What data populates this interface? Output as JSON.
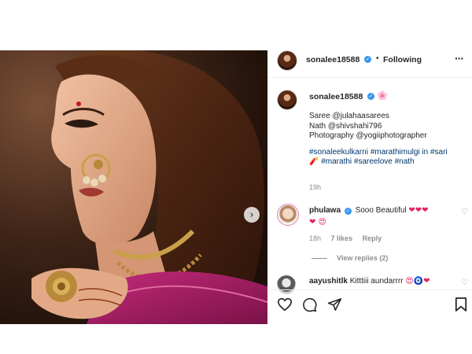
{
  "post": {
    "owner": {
      "username": "sonalee18588",
      "follow_status": "Following",
      "separator": "•"
    },
    "caption": {
      "username": "sonalee18588",
      "flower_emoji": "🌸",
      "lines": [
        "Saree @julahaasarees",
        "Nath @shivshahi796",
        "Photography @yogiiphotographer"
      ],
      "hashtags_line1": "#sonaleekulkarni #marathimulgi in #sari",
      "hashtags_line2_prefix": "🧨",
      "hashtags_line2": " #marathi #sareelove #nath",
      "time": "19h"
    },
    "comments": [
      {
        "username": "phulawa",
        "text": "Sooo Beautiful",
        "emojis_line1": "❤❤❤",
        "emojis_line2": "❤ 😍",
        "time": "18h",
        "likes": "7 likes",
        "reply_label": "Reply",
        "view_replies": "View replies (2)"
      },
      {
        "username": "aayushitlk",
        "text": "Kitttiii aundarrrr",
        "emojis": "😍🧿❤"
      }
    ],
    "icons": {
      "more": "more-options-icon",
      "like": "heart-icon",
      "comment": "comment-icon",
      "share": "share-icon",
      "save": "bookmark-icon",
      "carousel_next": "chevron-right-icon",
      "verified": "verified-badge-icon"
    },
    "colors": {
      "link": "#00376b",
      "verified": "#3897f0",
      "muted": "#8e8e8e",
      "heart": "#e0245e"
    }
  }
}
